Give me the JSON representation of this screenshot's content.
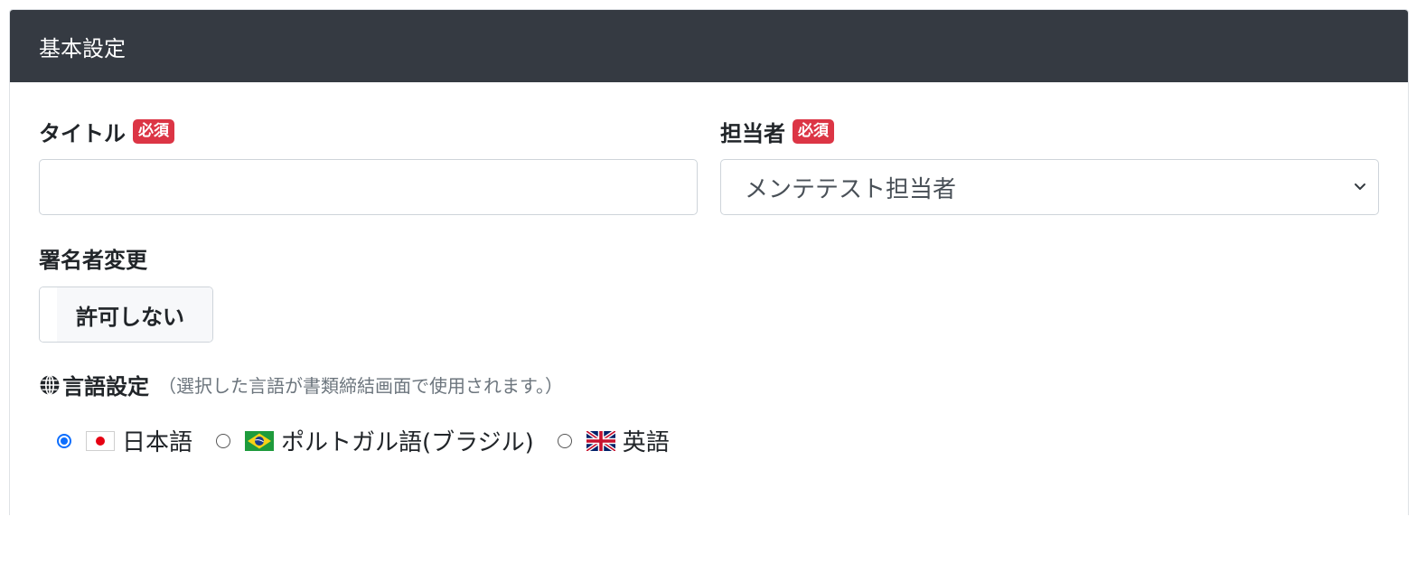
{
  "card": {
    "title": "基本設定"
  },
  "form": {
    "title_field": {
      "label": "タイトル",
      "required_badge": "必須",
      "value": "",
      "placeholder": ""
    },
    "assignee_field": {
      "label": "担当者",
      "required_badge": "必須",
      "selected": "メンテテスト担当者"
    },
    "signer_change": {
      "label": "署名者変更",
      "toggle_label": "許可しない"
    },
    "language": {
      "icon": "globe-icon",
      "label": "言語設定",
      "hint": "（選択した言語が書類締結画面で使用されます。）",
      "options": [
        {
          "label": "日本語",
          "flag": "japan-flag-icon",
          "checked": true
        },
        {
          "label": "ポルトガル語(ブラジル)",
          "flag": "brazil-flag-icon",
          "checked": false
        },
        {
          "label": "英語",
          "flag": "uk-flag-icon",
          "checked": false
        }
      ]
    }
  },
  "colors": {
    "header_bg": "#353a42",
    "required_badge": "#dc3545",
    "radio_accent": "#0d6efd"
  }
}
